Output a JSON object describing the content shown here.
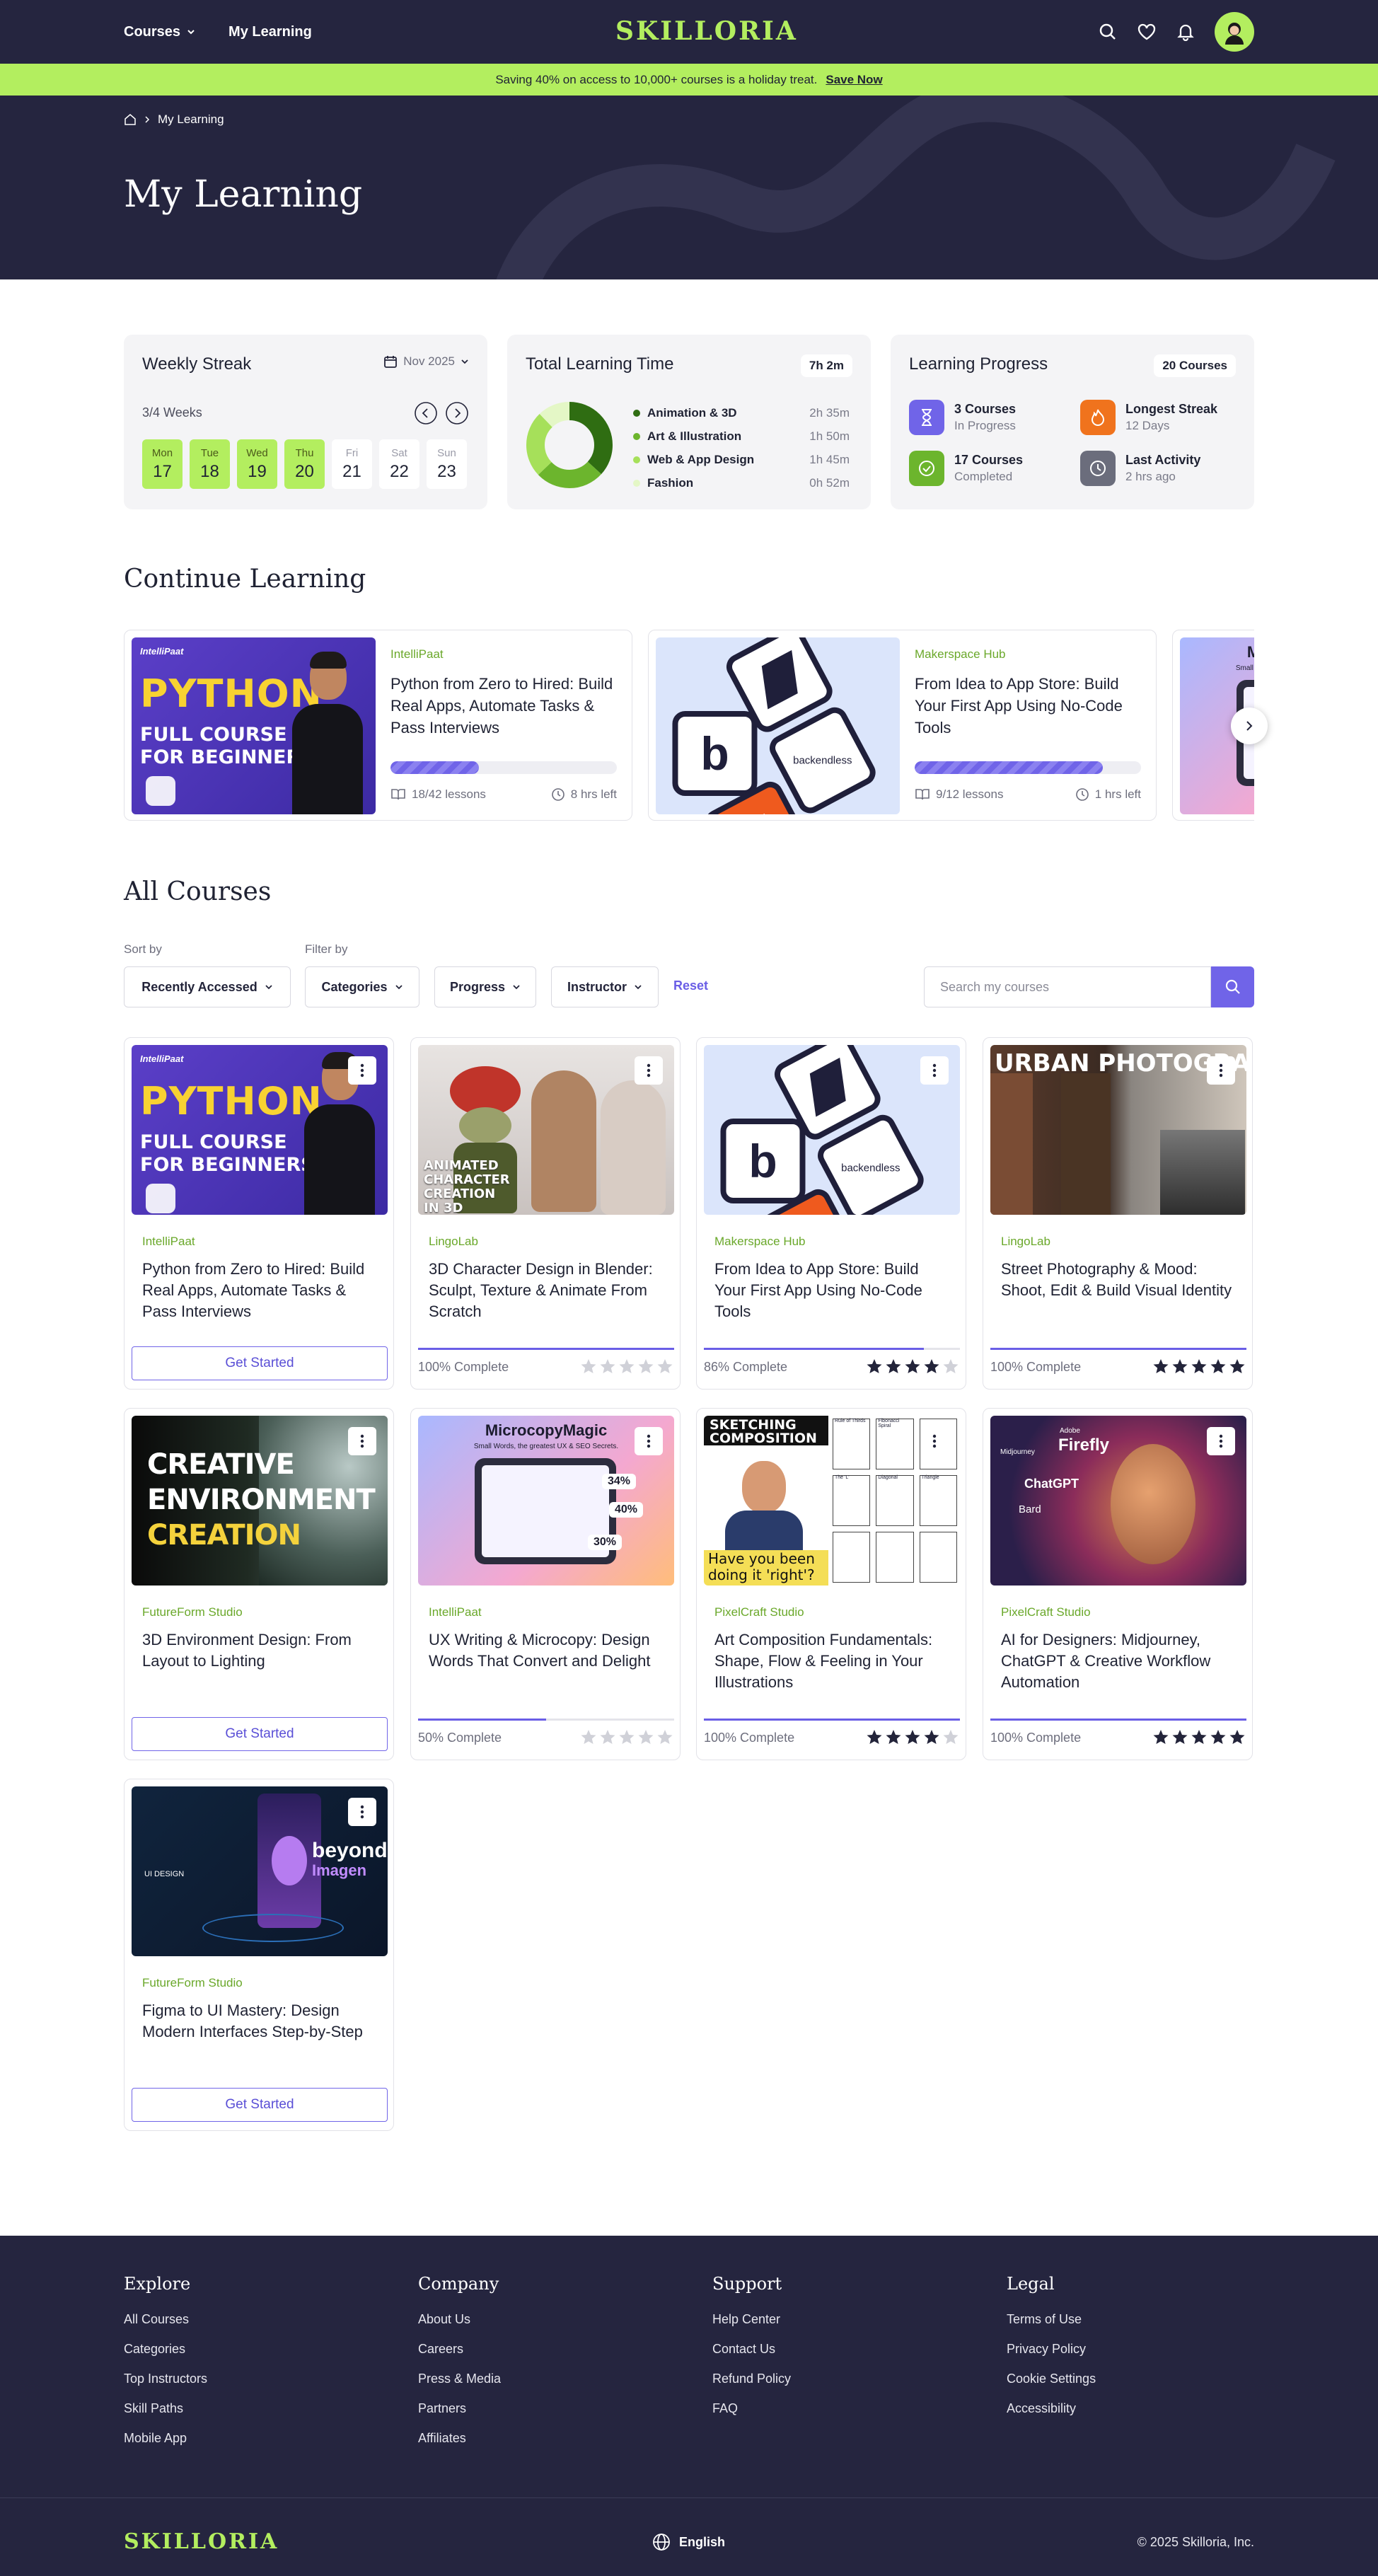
{
  "brand": {
    "logo": "SKILLORIA",
    "accent": "#b3ee5f",
    "dark": "#25253f",
    "primary": "#7064e8"
  },
  "nav": {
    "courses": "Courses",
    "my_learning": "My Learning",
    "icons": [
      "search-icon",
      "heart-icon",
      "bell-icon",
      "avatar"
    ]
  },
  "promo": {
    "text": "Saving 40% on access to 10,000+ courses is a holiday treat.",
    "cta": "Save Now"
  },
  "hero": {
    "breadcrumb": "My Learning",
    "title": "My Learning"
  },
  "streak": {
    "title": "Weekly Streak",
    "month": "Nov 2025",
    "weeks": "3/4 Weeks",
    "days": [
      {
        "name": "Mon",
        "date": "17",
        "active": true
      },
      {
        "name": "Tue",
        "date": "18",
        "active": true
      },
      {
        "name": "Wed",
        "date": "19",
        "active": true
      },
      {
        "name": "Thu",
        "date": "20",
        "active": true
      },
      {
        "name": "Fri",
        "date": "21",
        "active": false
      },
      {
        "name": "Sat",
        "date": "22",
        "active": false
      },
      {
        "name": "Sun",
        "date": "23",
        "active": false
      }
    ]
  },
  "learning_time": {
    "title": "Total Learning Time",
    "total": "7h 2m",
    "items": [
      {
        "label": "Animation & 3D",
        "value": "2h 35m",
        "minutes": 155,
        "color": "#2f6d12"
      },
      {
        "label": "Art & Illustration",
        "value": "1h 50m",
        "minutes": 110,
        "color": "#6cb52d"
      },
      {
        "label": "Web & App Design",
        "value": "1h 45m",
        "minutes": 105,
        "color": "#a6e05a"
      },
      {
        "label": "Fashion",
        "value": "0h 52m",
        "minutes": 52,
        "color": "#e4f7c6"
      }
    ]
  },
  "progress": {
    "title": "Learning Progress",
    "count": "20 Courses",
    "in_progress": {
      "value": "3 Courses",
      "label": "In Progress"
    },
    "completed": {
      "value": "17 Courses",
      "label": "Completed"
    },
    "streak": {
      "value": "Longest Streak",
      "label": "12 Days"
    },
    "activity": {
      "value": "Last Activity",
      "label": "2 hrs ago"
    }
  },
  "continue": {
    "title": "Continue Learning",
    "items": [
      {
        "provider": "IntelliPaat",
        "title": "Python from Zero to Hired: Build Real Apps, Automate Tasks & Pass Interviews",
        "lessons": "18/42 lessons",
        "time": "8 hrs left",
        "progress": 0.39
      },
      {
        "provider": "Makerspace Hub",
        "title": "From Idea to App Store: Build Your First App Using No-Code Tools",
        "lessons": "9/12 lessons",
        "time": "1 hrs left",
        "progress": 0.83
      }
    ]
  },
  "all_courses": {
    "title": "All Courses",
    "sort_label": "Sort by",
    "sort_value": "Recently Accessed",
    "filter_label": "Filter by",
    "filter_categories": "Categories",
    "filter_progress": "Progress",
    "filter_instructor": "Instructor",
    "reset": "Reset",
    "search_placeholder": "Search my courses",
    "get_started": "Get Started",
    "courses": [
      {
        "provider": "IntelliPaat",
        "title": "Python from Zero to Hired: Build Real Apps, Automate Tasks & Pass Interviews",
        "status": "new",
        "complete": "",
        "progress": 0,
        "rating": 0
      },
      {
        "provider": "LingoLab",
        "title": "3D Character Design in Blender: Sculpt, Texture & Animate From Scratch",
        "status": "progress",
        "complete": "100% Complete",
        "progress": 1.0,
        "rating": 0
      },
      {
        "provider": "Makerspace Hub",
        "title": "From Idea to App Store: Build Your First App Using No-Code Tools",
        "status": "progress",
        "complete": "86% Complete",
        "progress": 0.86,
        "rating": 4
      },
      {
        "provider": "LingoLab",
        "title": "Street Photography & Mood: Shoot, Edit & Build Visual Identity",
        "status": "progress",
        "complete": "100% Complete",
        "progress": 1.0,
        "rating": 5
      },
      {
        "provider": "FutureForm Studio",
        "title": "3D Environment Design: From Layout to Lighting",
        "status": "new",
        "complete": "",
        "progress": 0,
        "rating": 0
      },
      {
        "provider": "IntelliPaat",
        "title": "UX Writing & Microcopy: Design Words That Convert and Delight",
        "status": "progress",
        "complete": "50% Complete",
        "progress": 0.5,
        "rating": 0
      },
      {
        "provider": "PixelCraft Studio",
        "title": "Art Composition Fundamentals: Shape, Flow & Feeling in Your Illustrations",
        "status": "progress",
        "complete": "100% Complete",
        "progress": 1.0,
        "rating": 4
      },
      {
        "provider": "PixelCraft Studio",
        "title": "AI for Designers: Midjourney, ChatGPT & Creative Workflow Automation",
        "status": "progress",
        "complete": "100% Complete",
        "progress": 1.0,
        "rating": 5
      },
      {
        "provider": "FutureForm Studio",
        "title": "Figma to UI Mastery: Design Modern Interfaces Step-by-Step",
        "status": "new",
        "complete": "",
        "progress": 0,
        "rating": 0
      }
    ]
  },
  "thumbs": {
    "python": {
      "brand": "IntelliPaat",
      "l1": "PYTHON",
      "l2": "FULL COURSE",
      "l3": "FOR BEGINNERS"
    },
    "character": {
      "l1": "ANIMATED",
      "l2": "CHARACTER",
      "l3": "CREATION",
      "l4": "IN 3D"
    },
    "nocode": {
      "b": "b",
      "brand": "backendless"
    },
    "street": {
      "l1": "URBAN PHOTOGRAPHY"
    },
    "env": {
      "l1": "CREATIVE",
      "l2": "ENVIRONMENT",
      "l3": "CREATION"
    },
    "ux": {
      "l1": "MicrocopyMagic",
      "l2": "Small Words, the greatest UX & SEO Secrets.",
      "p1": "34%",
      "p2": "40%",
      "p3": "30%"
    },
    "sketch": {
      "l1": "SKETCHING",
      "l2": "COMPOSITION",
      "q1": "Have you been",
      "q2": "doing it 'right'?",
      "c1": "Rule of Thirds",
      "c2": "Fibonacci Spiral",
      "c3": "The 'L'",
      "c4": "Diagonal",
      "c5": "Triangle"
    },
    "ai": {
      "l1": "Midjourney",
      "l2": "Adobe",
      "l3": "Firefly",
      "l4": "ChatGPT",
      "l5": "Bard"
    },
    "figma": {
      "l1": "beyond",
      "l2": "Imagen",
      "l3": "UI DESIGN"
    }
  },
  "footer": {
    "explore": {
      "title": "Explore",
      "links": [
        "All Courses",
        "Categories",
        "Top Instructors",
        "Skill Paths",
        "Mobile App"
      ]
    },
    "company": {
      "title": "Company",
      "links": [
        "About Us",
        "Careers",
        "Press & Media",
        "Partners",
        "Affiliates"
      ]
    },
    "support": {
      "title": "Support",
      "links": [
        "Help Center",
        "Contact Us",
        "Refund Policy",
        "FAQ"
      ]
    },
    "legal": {
      "title": "Legal",
      "links": [
        "Terms of Use",
        "Privacy Policy",
        "Cookie Settings",
        "Accessibility"
      ]
    },
    "language": "English",
    "copyright": "© 2025 Skilloria, Inc."
  }
}
